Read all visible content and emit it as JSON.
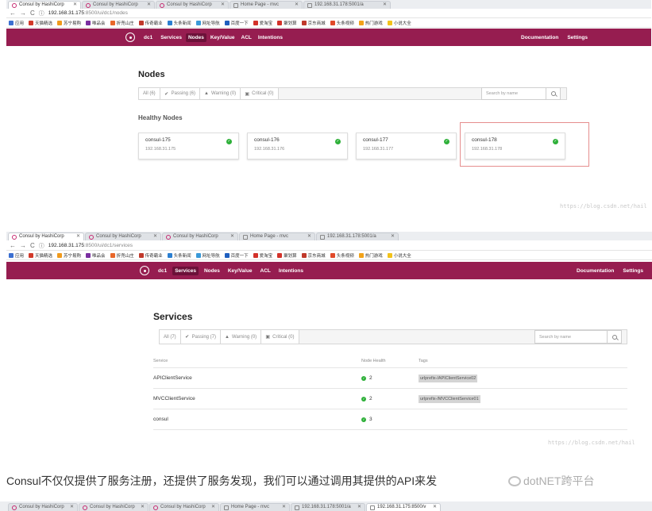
{
  "browser1": {
    "tabs": [
      {
        "label": "Consul by HashiCorp",
        "active": true
      },
      {
        "label": "Consul by HashiCorp",
        "active": false
      },
      {
        "label": "Consul by HashiCorp",
        "active": false
      },
      {
        "label": "Home Page - mvc",
        "active": false
      },
      {
        "label": "192.168.31.178:5001/a",
        "active": false
      }
    ],
    "url_host": "192.168.31.175",
    "url_rest": ":8500/ui/dc1/nodes",
    "bookmarks": [
      "应用",
      "天猫精选",
      "苏宁易购",
      "唯品会",
      "折兜山庄",
      "传奇霸业",
      "头条新闻",
      "网址导航",
      "百度一下",
      "爱淘宝",
      "聚划算",
      "京东商城",
      "头条视频",
      "热门游戏",
      "小说大全"
    ]
  },
  "consul1": {
    "nav": {
      "dc": "dc1",
      "items": [
        "Services",
        "Nodes",
        "Key/Value",
        "ACL",
        "Intentions"
      ],
      "active": "Nodes",
      "right": [
        "Documentation",
        "Settings"
      ]
    },
    "title": "Nodes",
    "filters": [
      "All (6)",
      "Passing (6)",
      "Warning (0)",
      "Critical (0)"
    ],
    "search_placeholder": "Search by name",
    "section": "Healthy Nodes",
    "nodes": [
      {
        "name": "consul-175",
        "ip": "192.168.31.175"
      },
      {
        "name": "consul-176",
        "ip": "192.168.31.176"
      },
      {
        "name": "consul-177",
        "ip": "192.168.31.177"
      },
      {
        "name": "consul-178",
        "ip": "192.168.31.178"
      }
    ],
    "watermark": "https://blog.csdn.net/hail"
  },
  "browser2": {
    "tabs": [
      {
        "label": "Consul by HashiCorp",
        "active": true
      },
      {
        "label": "Consul by HashiCorp",
        "active": false
      },
      {
        "label": "Consul by HashiCorp",
        "active": false
      },
      {
        "label": "Home Page - mvc",
        "active": false
      },
      {
        "label": "192.168.31.178:5001/a",
        "active": false
      }
    ],
    "url_host": "192.168.31.175",
    "url_rest": ":8500/ui/dc1/services",
    "bookmarks": [
      "应用",
      "天猫精选",
      "苏宁易购",
      "唯品会",
      "折兜山庄",
      "传奇霸业",
      "头条新闻",
      "网址导航",
      "百度一下",
      "爱淘宝",
      "聚划算",
      "京东商城",
      "头条视频",
      "热门游戏",
      "小说大全"
    ]
  },
  "consul2": {
    "nav": {
      "dc": "dc1",
      "items": [
        "Services",
        "Nodes",
        "Key/Value",
        "ACL",
        "Intentions"
      ],
      "active": "Services",
      "right": [
        "Documentation",
        "Settings"
      ]
    },
    "title": "Services",
    "filters": [
      "All (7)",
      "Passing (7)",
      "Warning (0)",
      "Critical (0)"
    ],
    "search_placeholder": "Search by name",
    "columns": [
      "Service",
      "Node Health",
      "Tags"
    ],
    "services": [
      {
        "name": "APIClientService",
        "health": "2",
        "tag": "urlprefix-/APIClientService02"
      },
      {
        "name": "MVCClientService",
        "health": "2",
        "tag": "urlprefix-/MVCClientService01"
      },
      {
        "name": "consul",
        "health": "3",
        "tag": ""
      }
    ],
    "watermark": "https://blog.csdn.net/hail"
  },
  "article": {
    "text": "Consul不仅仅提供了服务注册，还提供了服务发现，我们可以通过调用其提供的API来发",
    "wechat_watermark": "dotNET跨平台"
  },
  "browser3": {
    "tabs": [
      {
        "label": "Consul by HashiCorp",
        "active": false
      },
      {
        "label": "Consul by HashiCorp",
        "active": false
      },
      {
        "label": "Consul by HashiCorp",
        "active": false
      },
      {
        "label": "Home Page - mvc",
        "active": false
      },
      {
        "label": "192.168.31.178:5001/a",
        "active": false
      },
      {
        "label": "192.168.31.175:8500/v",
        "active": true
      }
    ]
  }
}
